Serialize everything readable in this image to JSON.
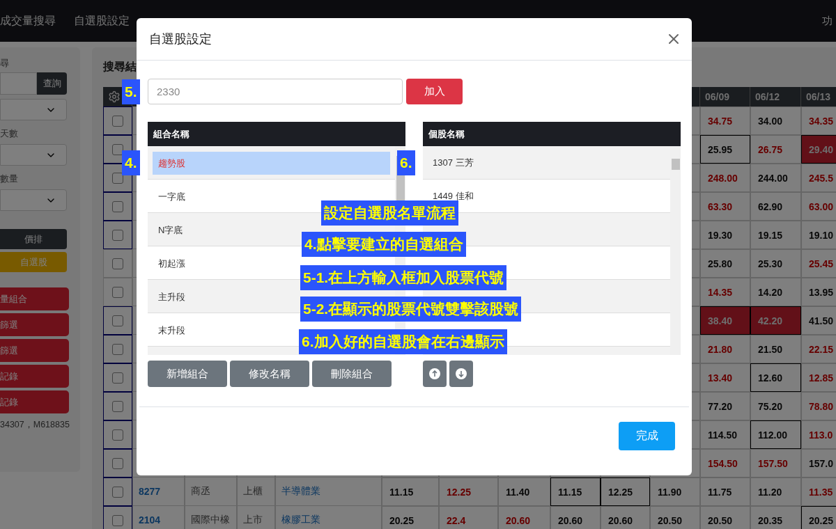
{
  "navbar": {
    "links": [
      "成交量搜尋",
      "自選股設定"
    ],
    "right_link": "功"
  },
  "sidebar": {
    "search_label": "尋",
    "search_button": "查詢",
    "days_label": "天數",
    "volume_label": "數量",
    "sort_button": "價排",
    "watchlist_button": "自選股",
    "action_buttons": [
      "量組合",
      "篩選",
      "篩選",
      "記錄",
      "記錄"
    ],
    "footer": "34307，M618835"
  },
  "results": {
    "title": "搜尋結",
    "date_columns": [
      "06/09",
      "06/12",
      "06/13"
    ],
    "rows": [
      {
        "highlighted": true,
        "values": [
          {
            "text": "34.75",
            "rising": true,
            "outlined": false,
            "filled": false
          },
          {
            "text": "34.00",
            "rising": false,
            "outlined": false,
            "filled": false
          },
          {
            "text": "34.35",
            "rising": true,
            "outlined": false,
            "filled": false
          }
        ]
      },
      {
        "highlighted": true,
        "values": [
          {
            "text": "25.95",
            "rising": false,
            "outlined": true,
            "filled": false
          },
          {
            "text": "26.75",
            "rising": true,
            "outlined": false,
            "filled": false
          },
          {
            "text": "29.40",
            "rising": true,
            "outlined": false,
            "filled": true
          }
        ]
      },
      {
        "highlighted": true,
        "values": [
          {
            "text": "248.00",
            "rising": true,
            "outlined": false,
            "filled": false
          },
          {
            "text": "244.00",
            "rising": false,
            "outlined": false,
            "filled": false
          },
          {
            "text": "245.5",
            "rising": true,
            "outlined": false,
            "filled": false
          }
        ]
      },
      {
        "highlighted": true,
        "values": [
          {
            "text": "63.30",
            "rising": true,
            "outlined": false,
            "filled": false
          },
          {
            "text": "62.90",
            "rising": false,
            "outlined": false,
            "filled": false
          },
          {
            "text": "63.00",
            "rising": true,
            "outlined": false,
            "filled": false
          }
        ]
      },
      {
        "highlighted": true,
        "values": [
          {
            "text": "19.30",
            "rising": false,
            "outlined": false,
            "filled": false
          },
          {
            "text": "19.15",
            "rising": false,
            "outlined": false,
            "filled": false
          },
          {
            "text": "19.10",
            "rising": false,
            "outlined": false,
            "filled": false
          }
        ]
      },
      {
        "highlighted": false,
        "values": [
          {
            "text": "25.80",
            "rising": false,
            "outlined": false,
            "filled": false
          },
          {
            "text": "25.30",
            "rising": false,
            "outlined": false,
            "filled": false
          },
          {
            "text": "25.45",
            "rising": true,
            "outlined": false,
            "filled": false
          }
        ]
      },
      {
        "highlighted": false,
        "values": [
          {
            "text": "14.35",
            "rising": true,
            "outlined": false,
            "filled": false
          },
          {
            "text": "14.20",
            "rising": false,
            "outlined": false,
            "filled": false
          },
          {
            "text": "13.95",
            "rising": false,
            "outlined": false,
            "filled": false
          }
        ]
      },
      {
        "highlighted": true,
        "values": [
          {
            "text": "38.40",
            "rising": true,
            "outlined": false,
            "filled": true
          },
          {
            "text": "42.20",
            "rising": true,
            "outlined": false,
            "filled": true
          },
          {
            "text": "41.50",
            "rising": false,
            "outlined": false,
            "filled": false
          }
        ]
      },
      {
        "highlighted": true,
        "values": [
          {
            "text": "21.80",
            "rising": true,
            "outlined": false,
            "filled": false
          },
          {
            "text": "21.50",
            "rising": false,
            "outlined": false,
            "filled": false
          },
          {
            "text": "22.15",
            "rising": true,
            "outlined": false,
            "filled": false
          }
        ]
      },
      {
        "highlighted": true,
        "values": [
          {
            "text": "13.40",
            "rising": true,
            "outlined": false,
            "filled": false
          },
          {
            "text": "12.60",
            "rising": false,
            "outlined": true,
            "filled": false
          },
          {
            "text": "12.85",
            "rising": true,
            "outlined": false,
            "filled": false
          }
        ]
      },
      {
        "highlighted": true,
        "values": [
          {
            "text": "77.20",
            "rising": false,
            "outlined": false,
            "filled": false
          },
          {
            "text": "75.20",
            "rising": false,
            "outlined": false,
            "filled": false
          },
          {
            "text": "78.80",
            "rising": true,
            "outlined": false,
            "filled": false
          }
        ]
      },
      {
        "highlighted": true,
        "values": [
          {
            "text": "114.50",
            "rising": false,
            "outlined": false,
            "filled": false
          },
          {
            "text": "112.00",
            "rising": false,
            "outlined": true,
            "filled": false
          },
          {
            "text": "113.0",
            "rising": true,
            "outlined": false,
            "filled": false
          }
        ]
      },
      {
        "highlighted": true,
        "values": [
          {
            "text": "154.50",
            "rising": true,
            "outlined": false,
            "filled": false
          },
          {
            "text": "157.50",
            "rising": true,
            "outlined": false,
            "filled": false
          },
          {
            "text": "157.0",
            "rising": false,
            "outlined": false,
            "filled": false
          }
        ]
      },
      {
        "highlighted": true,
        "code": "8277",
        "name": "商丞",
        "market": "上櫃",
        "industry": "半導體業",
        "values": [
          {
            "text": "11.15",
            "rising": false,
            "outlined": false,
            "filled": false
          },
          {
            "text": "12.25",
            "rising": true,
            "outlined": false,
            "filled": false
          },
          {
            "text": "11.40",
            "rising": false,
            "outlined": false,
            "filled": false
          },
          {
            "text": "11.15",
            "rising": false,
            "outlined": true,
            "filled": false
          },
          {
            "text": "12.25",
            "rising": false,
            "outlined": true,
            "filled": false
          },
          {
            "text": "11.90",
            "rising": false,
            "outlined": false,
            "filled": false
          },
          {
            "text": "11.75",
            "rising": false,
            "outlined": false,
            "filled": false
          },
          {
            "text": "11.20",
            "rising": false,
            "outlined": false,
            "filled": false
          },
          {
            "text": "11.35",
            "rising": true,
            "outlined": false,
            "filled": false
          }
        ]
      },
      {
        "highlighted": true,
        "code": "2104",
        "name": "國際中橡",
        "market": "上市",
        "industry": "橡膠工業",
        "values": [
          {
            "text": "20.25",
            "rising": false,
            "outlined": false,
            "filled": false
          },
          {
            "text": "22.4",
            "rising": true,
            "outlined": false,
            "filled": false
          },
          {
            "text": "20.60",
            "rising": true,
            "outlined": false,
            "filled": false
          },
          {
            "text": "20.60",
            "rising": false,
            "outlined": false,
            "filled": false
          },
          {
            "text": "20.60",
            "rising": false,
            "outlined": false,
            "filled": false
          },
          {
            "text": "20.50",
            "rising": false,
            "outlined": false,
            "filled": false
          },
          {
            "text": "20.50",
            "rising": false,
            "outlined": false,
            "filled": false
          },
          {
            "text": "20.35",
            "rising": false,
            "outlined": false,
            "filled": false
          },
          {
            "text": "20.25",
            "rising": false,
            "outlined": true,
            "filled": false
          }
        ]
      }
    ]
  },
  "dialog": {
    "title": "自選股設定",
    "code_field": {
      "placeholder": "2330"
    },
    "add_button": "加入",
    "groups": {
      "header": "組合名稱",
      "items": [
        {
          "label": "趨勢股",
          "selected": true
        },
        {
          "label": "一字底",
          "selected": false
        },
        {
          "label": "N字底",
          "selected": false
        },
        {
          "label": "初起漲",
          "selected": false
        },
        {
          "label": "主升段",
          "selected": false
        },
        {
          "label": "末升段",
          "selected": false
        }
      ]
    },
    "stocks": {
      "header": "個股名稱",
      "items": [
        "1307 三芳",
        "1449 佳和"
      ]
    },
    "group_buttons": [
      "新增組合",
      "修改名稱",
      "刪除組合"
    ],
    "done_button": "完成"
  },
  "callouts": [
    "5.",
    "4.",
    "6.",
    "設定自選股名單流程",
    "4.點擊要建立的自選組合",
    "5-1.在上方輸入框加入股票代號",
    "5-2.在顯示的股票代號雙擊該股號",
    "6.加入好的自選股會在右邊顯示"
  ]
}
